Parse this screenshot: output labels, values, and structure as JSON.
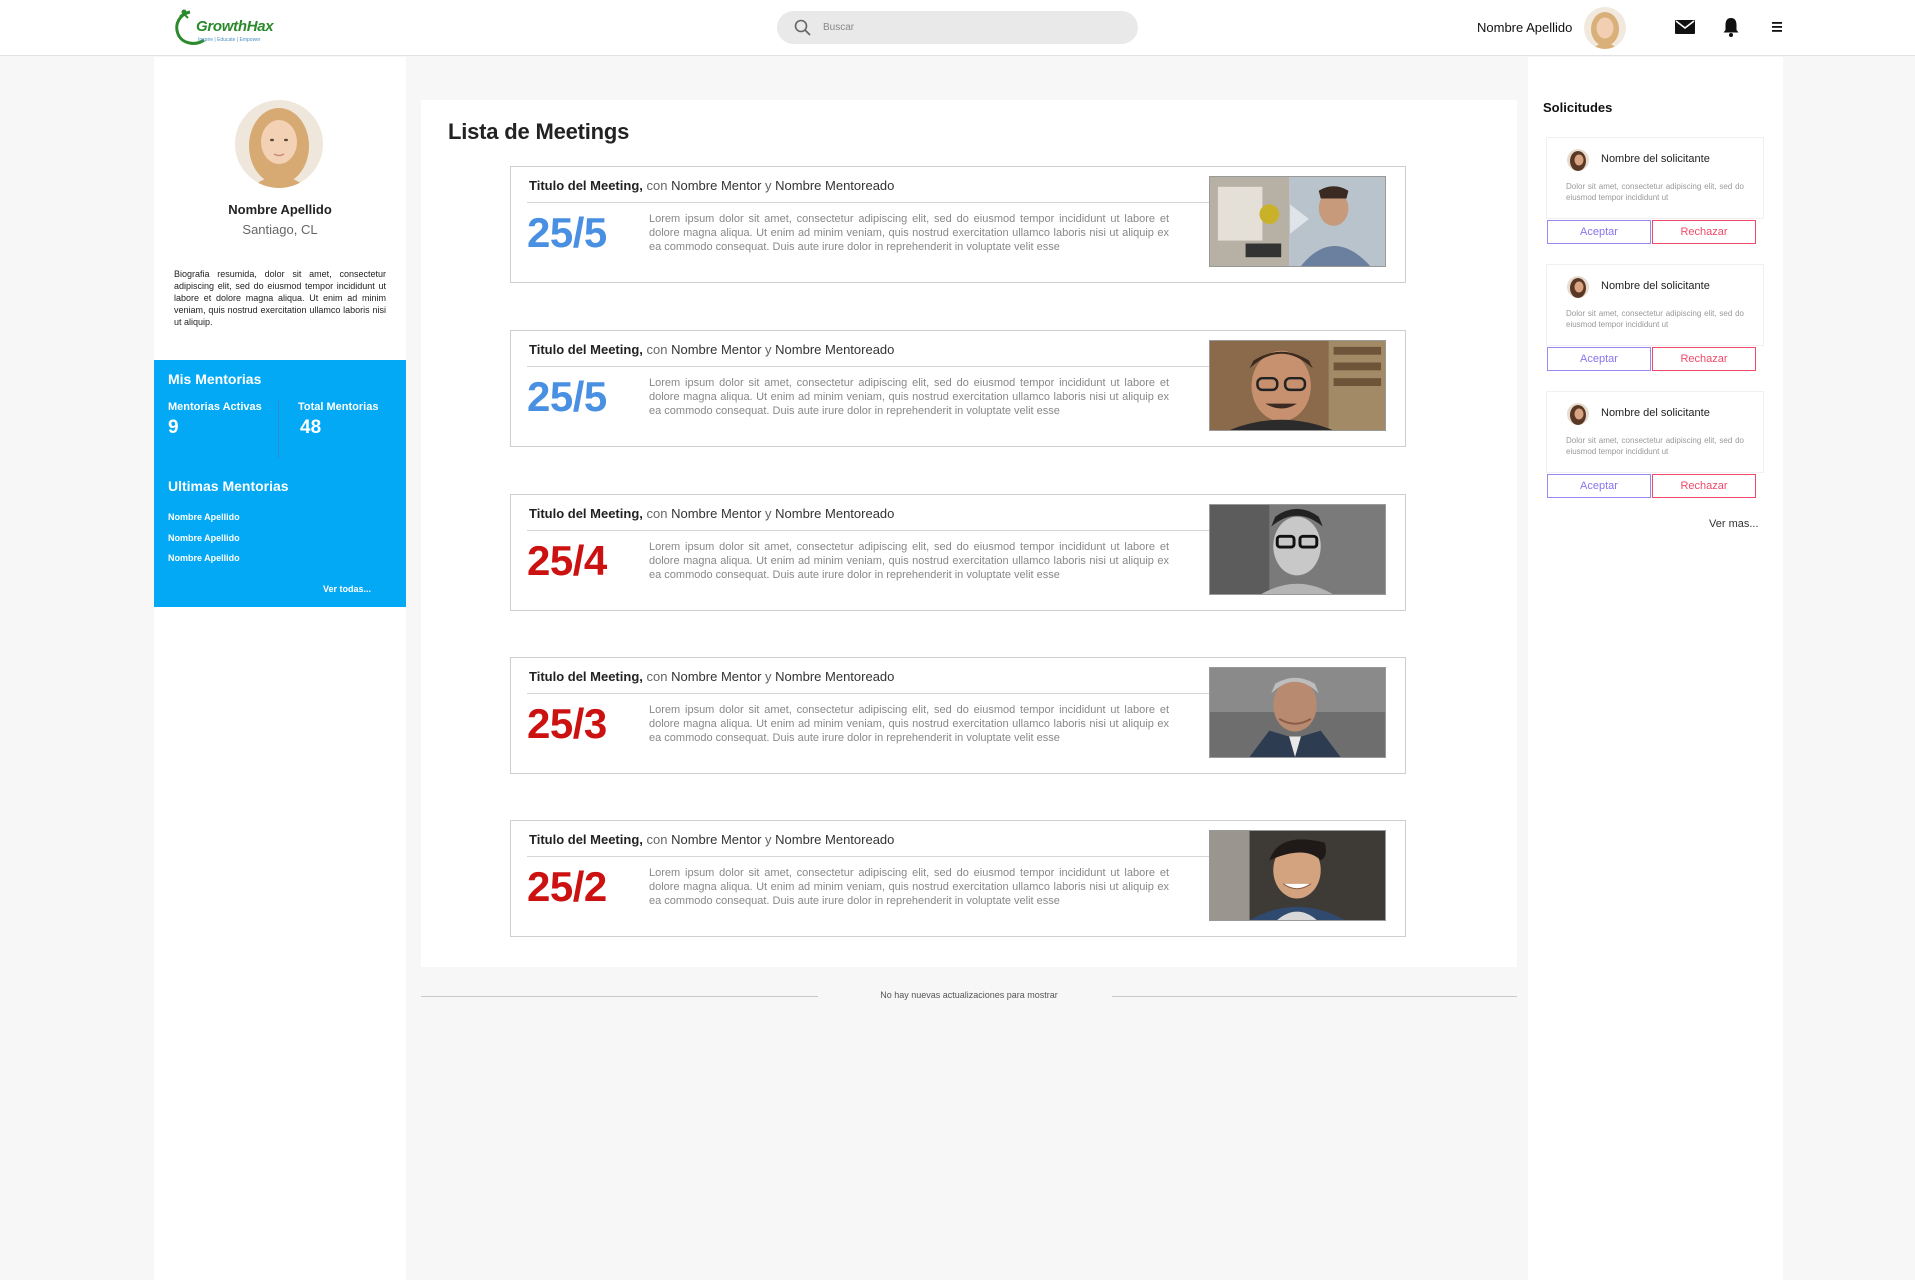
{
  "brand": {
    "name": "GrowthHax",
    "tagline": "Inspire | Educate | Empower"
  },
  "search": {
    "placeholder": "Buscar"
  },
  "header": {
    "user_name": "Nombre Apellido"
  },
  "icons": {
    "mail": "mail-icon",
    "bell": "bell-icon",
    "menu": "hamburger-menu-icon",
    "search": "search-icon"
  },
  "profile": {
    "name": "Nombre Apellido",
    "location": "Santiago, CL",
    "bio": "Biografia resumida, dolor sit amet, consectetur adipiscing elit, sed do eiusmod tempor incididunt ut labore et dolore magna aliqua. Ut enim ad minim veniam, quis nostrud exercitation ullamco laboris nisi ut aliquip."
  },
  "mentorias": {
    "title": "Mis Mentorias",
    "active_label": "Mentorias Activas",
    "active_value": "9",
    "total_label": "Total Mentorias",
    "total_value": "48",
    "latest_title": "Ultimas Mentorias",
    "latest": [
      "Nombre Apellido",
      "Nombre Apellido",
      "Nombre Apellido"
    ],
    "see_all": "Ver todas..."
  },
  "main": {
    "title": "Lista de Meetings",
    "meetings": [
      {
        "title": "Titulo del Meeting,",
        "con": "con",
        "mentor": "Nombre Mentor",
        "y": "y",
        "mentee": "Nombre Mentoreado",
        "date": "25/5",
        "status_color": "#4a90e2",
        "desc": "Lorem ipsum dolor sit amet, consectetur adipiscing elit, sed do eiusmod tempor incididunt ut labore et dolore magna aliqua. Ut enim ad minim veniam, quis nostrud exercitation ullamco laboris nisi ut aliquip ex ea commodo consequat. Duis aute irure dolor in reprehenderit in voluptate velit esse"
      },
      {
        "title": "Titulo del Meeting,",
        "con": "con",
        "mentor": "Nombre Mentor",
        "y": "y",
        "mentee": "Nombre Mentoreado",
        "date": "25/5",
        "status_color": "#4a90e2",
        "desc": "Lorem ipsum dolor sit amet, consectetur adipiscing elit, sed do eiusmod tempor incididunt ut labore et dolore magna aliqua. Ut enim ad minim veniam, quis nostrud exercitation ullamco laboris nisi ut aliquip ex ea commodo consequat. Duis aute irure dolor in reprehenderit in voluptate velit esse"
      },
      {
        "title": "Titulo del Meeting,",
        "con": "con",
        "mentor": "Nombre Mentor",
        "y": "y",
        "mentee": "Nombre Mentoreado",
        "date": "25/4",
        "status_color": "#cc1111",
        "desc": "Lorem ipsum dolor sit amet, consectetur adipiscing elit, sed do eiusmod tempor incididunt ut labore et dolore magna aliqua. Ut enim ad minim veniam, quis nostrud exercitation ullamco laboris nisi ut aliquip ex ea commodo consequat. Duis aute irure dolor in reprehenderit in voluptate velit esse"
      },
      {
        "title": "Titulo del Meeting,",
        "con": "con",
        "mentor": "Nombre Mentor",
        "y": "y",
        "mentee": "Nombre Mentoreado",
        "date": "25/3",
        "status_color": "#cc1111",
        "desc": "Lorem ipsum dolor sit amet, consectetur adipiscing elit, sed do eiusmod tempor incididunt ut labore et dolore magna aliqua. Ut enim ad minim veniam, quis nostrud exercitation ullamco laboris nisi ut aliquip ex ea commodo consequat. Duis aute irure dolor in reprehenderit in voluptate velit esse"
      },
      {
        "title": "Titulo del Meeting,",
        "con": "con",
        "mentor": "Nombre Mentor",
        "y": "y",
        "mentee": "Nombre Mentoreado",
        "date": "25/2",
        "status_color": "#cc1111",
        "desc": "Lorem ipsum dolor sit amet, consectetur adipiscing elit, sed do eiusmod tempor incididunt ut labore et dolore magna aliqua. Ut enim ad minim veniam, quis nostrud exercitation ullamco laboris nisi ut aliquip ex ea commodo consequat. Duis aute irure dolor in reprehenderit in voluptate velit esse"
      }
    ],
    "no_updates": "No hay nuevas actualizaciones para mostrar"
  },
  "requests": {
    "title": "Solicitudes",
    "items": [
      {
        "name": "Nombre del solicitante",
        "text": "Dolor sit amet, consectetur adipiscing elit, sed do eiusmod tempor incididunt ut",
        "accept": "Aceptar",
        "reject": "Rechazar"
      },
      {
        "name": "Nombre del solicitante",
        "text": "Dolor sit amet, consectetur adipiscing elit, sed do eiusmod tempor incididunt ut",
        "accept": "Aceptar",
        "reject": "Rechazar"
      },
      {
        "name": "Nombre del solicitante",
        "text": "Dolor sit amet, consectetur adipiscing elit, sed do eiusmod tempor incididunt ut",
        "accept": "Aceptar",
        "reject": "Rechazar"
      }
    ],
    "more": "Ver mas..."
  },
  "colors": {
    "accent_blue": "#03a9f4",
    "date_upcoming": "#4a90e2",
    "date_past": "#cc1111",
    "accept": "#8a74ee",
    "reject": "#ef4a6a"
  }
}
